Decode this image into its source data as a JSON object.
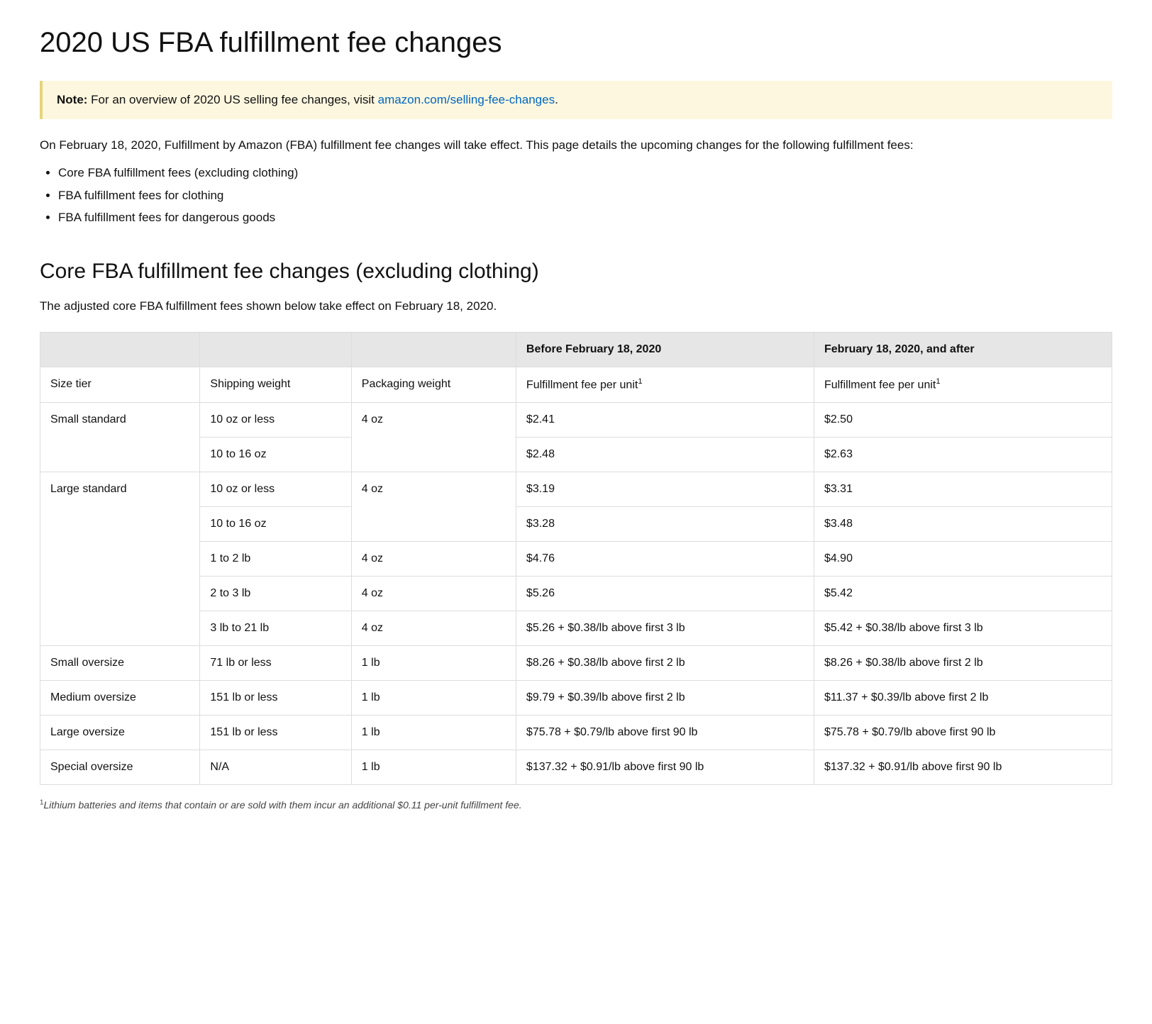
{
  "page_title": "2020 US FBA fulfillment fee changes",
  "note": {
    "label": "Note:",
    "text_before_link": " For an overview of 2020 US selling fee changes, visit ",
    "link_text": "amazon.com/selling-fee-changes",
    "text_after_link": "."
  },
  "intro": "On February 18, 2020, Fulfillment by Amazon (FBA) fulfillment fee changes will take effect. This page details the upcoming changes for the following fulfillment fees:",
  "intro_bullets": [
    "Core FBA fulfillment fees (excluding clothing)",
    "FBA fulfillment fees for clothing",
    "FBA fulfillment fees for dangerous goods"
  ],
  "section_core": {
    "heading": "Core FBA fulfillment fee changes (excluding clothing)",
    "caption": "The adjusted core FBA fulfillment fees shown below take effect on February 18, 2020."
  },
  "table": {
    "head": {
      "before": "Before February 18, 2020",
      "after": "February 18, 2020, and after"
    },
    "sub_labels": {
      "size_tier": "Size tier",
      "shipping_weight": "Shipping weight",
      "packaging_weight": "Packaging weight",
      "fee_before": "Fulfillment fee per unit",
      "fee_after": "Fulfillment fee per unit",
      "sup": "1"
    },
    "rows": [
      {
        "size": "Small standard",
        "size_rowspan": 2,
        "ship": "10 oz or less",
        "pack": "4 oz",
        "pack_rowspan": 2,
        "before": "$2.41",
        "after": "$2.50"
      },
      {
        "ship": "10 to 16 oz",
        "before": "$2.48",
        "after": "$2.63"
      },
      {
        "size": "Large standard",
        "size_rowspan": 5,
        "ship": "10 oz or less",
        "pack": "4 oz",
        "pack_rowspan": 2,
        "before": "$3.19",
        "after": "$3.31"
      },
      {
        "ship": "10 to 16 oz",
        "before": "$3.28",
        "after": "$3.48"
      },
      {
        "ship": "1 to 2 lb",
        "pack": "4 oz",
        "before": "$4.76",
        "after": "$4.90"
      },
      {
        "ship": "2 to 3 lb",
        "pack": "4 oz",
        "before": "$5.26",
        "after": "$5.42"
      },
      {
        "ship": "3 lb to 21 lb",
        "pack": "4 oz",
        "before": "$5.26 + $0.38/lb above first 3 lb",
        "after": "$5.42 + $0.38/lb above first 3 lb"
      },
      {
        "size": "Small oversize",
        "ship": "71 lb or less",
        "pack": "1 lb",
        "before": "$8.26 + $0.38/lb above first 2 lb",
        "after": "$8.26 + $0.38/lb above first 2 lb"
      },
      {
        "size": "Medium oversize",
        "ship": "151 lb or less",
        "pack": "1 lb",
        "before": "$9.79 + $0.39/lb above first 2 lb",
        "after": "$11.37 + $0.39/lb above first 2 lb"
      },
      {
        "size": "Large oversize",
        "ship": "151 lb or less",
        "pack": "1 lb",
        "before": "$75.78 + $0.79/lb above first 90 lb",
        "after": "$75.78 + $0.79/lb above first 90 lb"
      },
      {
        "size": "Special oversize",
        "ship": "N/A",
        "pack": "1 lb",
        "before": "$137.32 + $0.91/lb above first 90 lb",
        "after": "$137.32 + $0.91/lb above first 90 lb"
      }
    ]
  },
  "footnote": {
    "sup": "1",
    "text": "Lithium batteries and items that contain or are sold with them incur an additional $0.11 per-unit fulfillment fee."
  }
}
